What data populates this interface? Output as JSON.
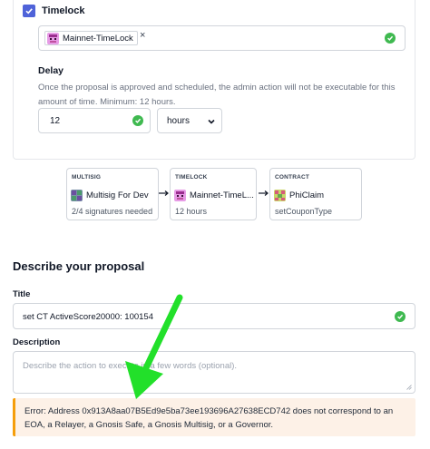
{
  "timelock": {
    "checkbox_label": "Timelock",
    "checked": true,
    "selected_chip": "Mainnet-TimeLock",
    "chip_remove": "×",
    "delay_title": "Delay",
    "delay_help": "Once the proposal is approved and scheduled, the admin action will not be executable for this amount of time. Minimum: 12 hours.",
    "delay_value": "12",
    "delay_unit": "hours"
  },
  "flow": [
    {
      "kind": "MULTISIG",
      "name": "Multisig For Dev",
      "sub": "2/4 signatures needed"
    },
    {
      "kind": "TIMELOCK",
      "name": "Mainnet-TimeL...",
      "sub": "12 hours"
    },
    {
      "kind": "CONTRACT",
      "name": "PhiClaim",
      "sub": "setCouponType"
    }
  ],
  "proposal": {
    "section_title": "Describe your proposal",
    "title_label": "Title",
    "title_value": "set CT ActiveScore20000: 100154",
    "description_label": "Description",
    "description_placeholder": "Describe the action to execute in a few words (optional)."
  },
  "error": {
    "message": "Error: Address 0x913A8aa07B5Ed9e5ba73ee193696A27638ECD742 does not correspond to an EOA, a Relayer, a Gnosis Safe, a Gnosis Multisig, or a Governor."
  },
  "colors": {
    "accent": "#4f63d9",
    "success": "#3fb950",
    "warning": "#f59e0b",
    "annotation_arrow": "#22e02a"
  }
}
